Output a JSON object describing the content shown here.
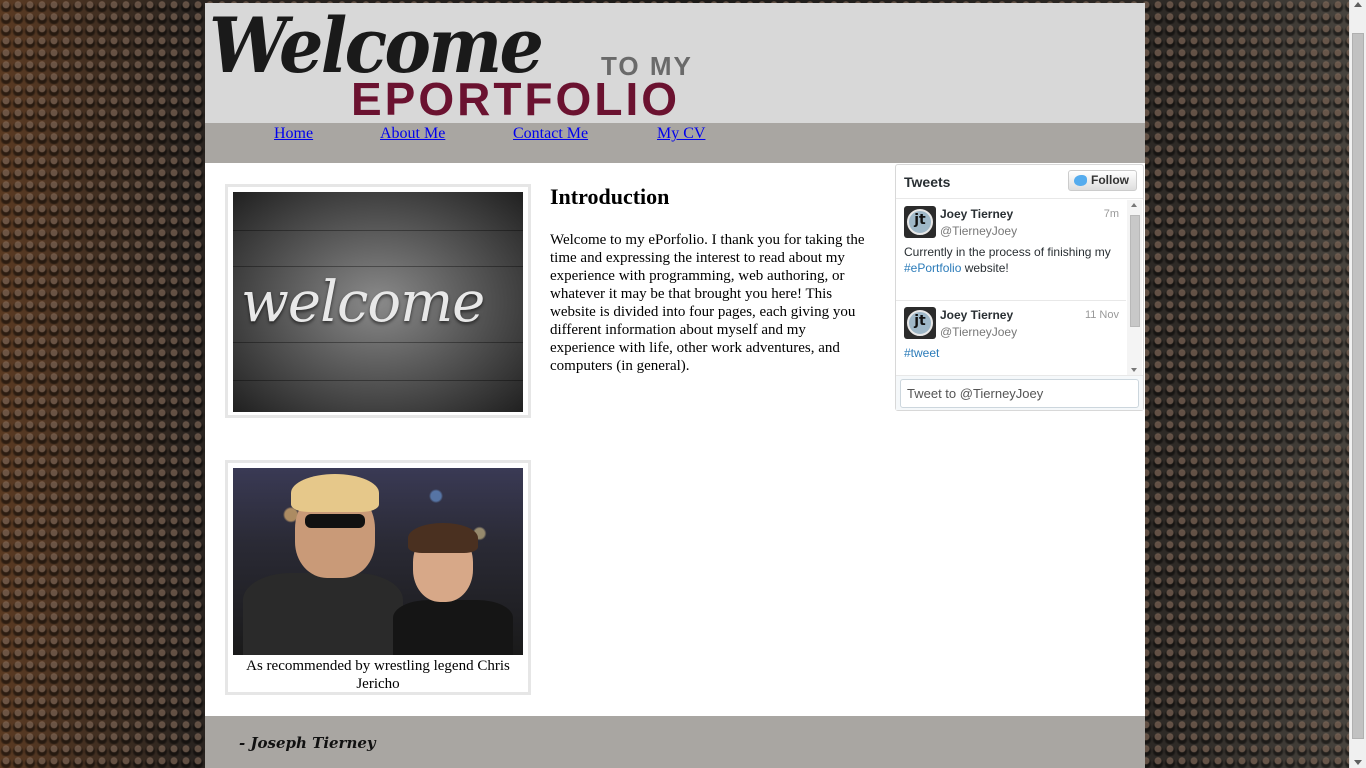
{
  "header": {
    "logo_welcome": "Welcome",
    "logo_tomy": "TO MY",
    "logo_eportfolio": "EPORTFOLIO"
  },
  "nav": {
    "items": [
      {
        "label": "Home"
      },
      {
        "label": "About Me"
      },
      {
        "label": "Contact Me"
      },
      {
        "label": "My CV"
      }
    ]
  },
  "main": {
    "welcome_image_text": "welcome",
    "intro_title": "Introduction",
    "intro_text": "Welcome to my ePorfolio. I thank you for taking the time and expressing the interest to read about my experience with programming, web authoring, or whatever it may be that brought you here! This website is divided into four pages, each giving you different information about myself and my experience with life, other work adventures, and computers (in general).",
    "photo_caption": "As recommended by wrestling legend Chris Jericho"
  },
  "twitter": {
    "title": "Tweets",
    "follow_label": "Follow",
    "avatar_mark": "jt",
    "tweets": [
      {
        "name": "Joey Tierney",
        "handle": "@TierneyJoey",
        "time": "7m",
        "text_before": "Currently in the process of finishing my ",
        "hashtag": "#ePortfolio",
        "text_after": " website!"
      },
      {
        "name": "Joey Tierney",
        "handle": "@TierneyJoey",
        "time": "11 Nov",
        "text_before": "",
        "hashtag": "#tweet",
        "text_after": ""
      }
    ],
    "compose_placeholder": "Tweet to @TierneyJoey"
  },
  "footer": {
    "signature": "- Joseph Tierney"
  },
  "colors": {
    "nav_bar": "#a9a6a2",
    "header_bg": "#d8d8d8",
    "eportfolio_accent": "#6b1230",
    "link": "#0000ee",
    "twitter_blue": "#55acee"
  },
  "icons": [
    "twitter-bird-icon",
    "scroll-up-arrow-icon",
    "scroll-down-arrow-icon"
  ]
}
